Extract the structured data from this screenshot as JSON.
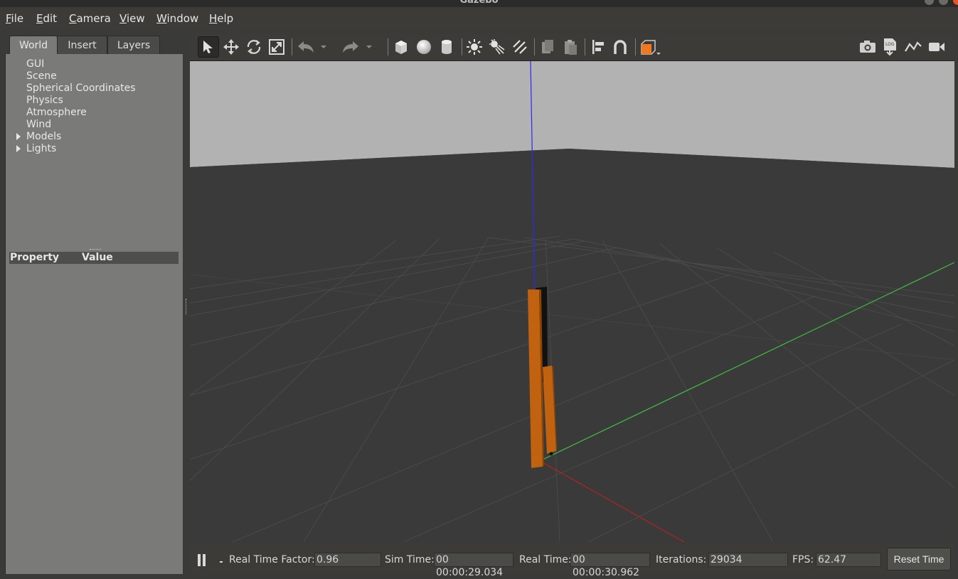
{
  "window": {
    "title": "Gazebo"
  },
  "menu": [
    "File",
    "Edit",
    "Camera",
    "View",
    "Window",
    "Help"
  ],
  "left_panel": {
    "tabs": [
      "World",
      "Insert",
      "Layers"
    ],
    "active_tab": "World",
    "tree": [
      {
        "label": "GUI",
        "expandable": false
      },
      {
        "label": "Scene",
        "expandable": false
      },
      {
        "label": "Spherical Coordinates",
        "expandable": false
      },
      {
        "label": "Physics",
        "expandable": false
      },
      {
        "label": "Atmosphere",
        "expandable": false
      },
      {
        "label": "Wind",
        "expandable": false
      },
      {
        "label": "Models",
        "expandable": true
      },
      {
        "label": "Lights",
        "expandable": true
      }
    ],
    "property_header": {
      "property": "Property",
      "value": "Value"
    }
  },
  "toolbar": {
    "tools": [
      "select-arrow-icon",
      "translate-icon",
      "rotate-icon",
      "scale-icon",
      "undo-icon",
      "undo-dropdown-icon",
      "redo-icon",
      "redo-dropdown-icon",
      "box-shape-icon",
      "sphere-shape-icon",
      "cylinder-shape-icon",
      "point-light-icon",
      "spot-light-icon",
      "directional-light-icon",
      "copy-icon",
      "paste-icon",
      "align-icon",
      "snap-icon",
      "view-angle-icon"
    ],
    "right_tools": [
      "screenshot-icon",
      "log-icon",
      "plot-icon",
      "video-record-icon"
    ],
    "log_label": "LOG"
  },
  "colors": {
    "model_orange": "#c0620f",
    "model_black": "#111111",
    "axis_x": "#b42222",
    "axis_y": "#3fbf3f",
    "axis_z": "#2a2aee",
    "sky": "#b2b2b2",
    "ground": "#3a3a3a",
    "accent": "#f07820"
  },
  "status": {
    "real_time_factor_label": "Real Time Factor:",
    "real_time_factor": "0.96",
    "sim_time_label": "Sim Time:",
    "sim_time": "00 00:00:29.034",
    "real_time_label": "Real Time:",
    "real_time": "00 00:00:30.962",
    "iterations_label": "Iterations:",
    "iterations": "29034",
    "fps_label": "FPS:",
    "fps": "62.47",
    "reset_label": "Reset Time"
  }
}
